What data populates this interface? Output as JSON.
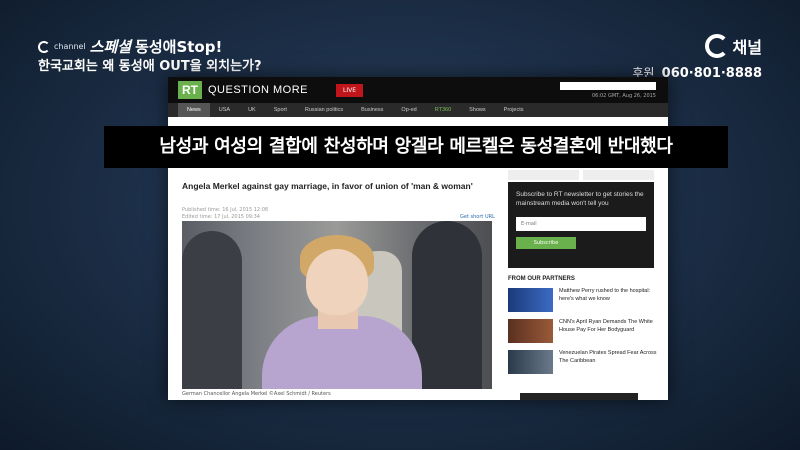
{
  "broadcast": {
    "channel_small": "channel",
    "program_script": "스페셜",
    "program_title": "동성애Stop!",
    "subtitle": "한국교회는 왜 동성애 OUT을 외치는가?",
    "channel_name": "채널",
    "sponsor_label": "후원",
    "sponsor_number": "060·801·8888",
    "overlay_caption": "남성과 여성의 결합에 찬성하며 앙겔라 메르켈은 동성결혼에 반대했다"
  },
  "rt": {
    "logo": "RT",
    "tagline": "QUESTION MORE",
    "live": "LIVE",
    "date": "06:02 GMT, Aug 26, 2015",
    "nav": [
      "News",
      "USA",
      "UK",
      "Sport",
      "Russian politics",
      "Business",
      "Op-ed",
      "RT360",
      "Shows",
      "Projects"
    ]
  },
  "article": {
    "title": "Angela Merkel against gay marriage, in favor of union of 'man & woman'",
    "published": "Published time: 16 Jul, 2015 12:08",
    "edited": "Edited time: 17 Jul, 2015 09:34",
    "short_url": "Get short URL",
    "photo_caption": "German Chancellor Angela Merkel ©Axel Schmidt / Reuters"
  },
  "sidebar": {
    "newsletter_text": "Subscribe to RT newsletter to get stories the mainstream media won't tell you",
    "email_placeholder": "E-mail",
    "subscribe_label": "Subscribe",
    "partners_title": "FROM OUR PARTNERS",
    "partners": [
      {
        "text": "Matthew Perry rushed to the hospital: here's what we know"
      },
      {
        "text": "CNN's April Ryan Demands The White House Pay For Her Bodyguard"
      },
      {
        "text": "Venezuelan Pirates Spread Fear Across The Caribbean"
      }
    ]
  },
  "colors": {
    "rt_green": "#6ab04c",
    "live_red": "#c0161b",
    "background": "#1d3049"
  }
}
